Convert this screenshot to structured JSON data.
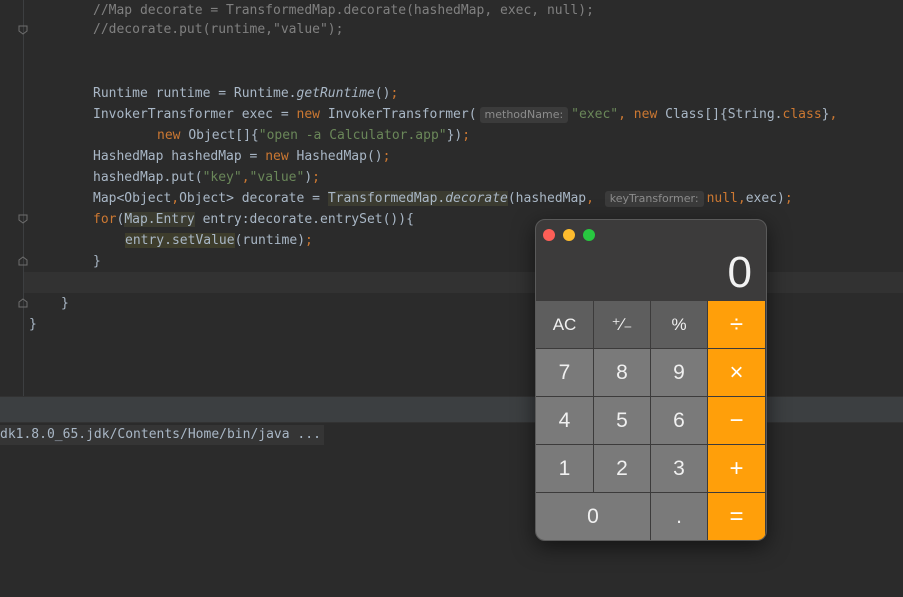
{
  "editor": {
    "hints": {
      "method_name": "methodName:",
      "key_transformer": "keyTransformer:"
    },
    "lines": {
      "l1": "//Map decorate = TransformedMap.decorate(hashedMap, exec, null);",
      "l2": "//decorate.put(runtime,\"value\");"
    }
  },
  "console": {
    "command": "dk1.8.0_65.jdk/Contents/Home/bin/java ..."
  },
  "calculator": {
    "display": "0",
    "keys": {
      "ac": "AC",
      "sign": "⁺∕₋",
      "percent": "%",
      "divide": "÷",
      "seven": "7",
      "eight": "8",
      "nine": "9",
      "multiply": "×",
      "four": "4",
      "five": "5",
      "six": "6",
      "minus": "−",
      "one": "1",
      "two": "2",
      "three": "3",
      "plus": "+",
      "zero": "0",
      "decimal": ".",
      "equals": "="
    },
    "colors": {
      "operator": "#ff9f0a",
      "function": "#5e5e5e",
      "number": "#7a7a7a"
    }
  }
}
